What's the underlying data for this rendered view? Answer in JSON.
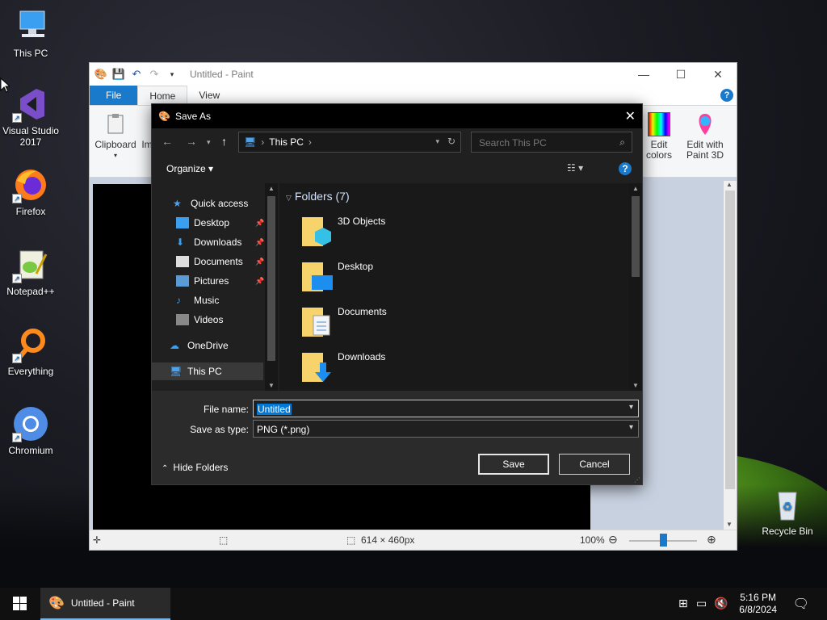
{
  "desktop": {
    "icons": [
      {
        "label": "This PC"
      },
      {
        "label": "Visual Studio\n2017"
      },
      {
        "label": "Firefox"
      },
      {
        "label": "Notepad++"
      },
      {
        "label": "Everything"
      },
      {
        "label": "Chromium"
      },
      {
        "label": "Recycle Bin"
      }
    ]
  },
  "paint": {
    "title": "Untitled - Paint",
    "tabs": {
      "file": "File",
      "home": "Home",
      "view": "View"
    },
    "ribbon": {
      "clipboard": "Clipboard",
      "edit_colors": "Edit\ncolors",
      "edit_paint3d": "Edit with\nPaint 3D",
      "images_partial": "Im"
    },
    "status": {
      "dimensions": "614 × 460px",
      "zoom": "100%",
      "zoom_fraction": 0.55
    }
  },
  "dialog": {
    "title": "Save As",
    "address": "This PC",
    "search_placeholder": "Search This PC",
    "organize": "Organize",
    "nav": [
      {
        "label": "Quick access",
        "pinned": false
      },
      {
        "label": "Desktop",
        "pinned": true
      },
      {
        "label": "Downloads",
        "pinned": true
      },
      {
        "label": "Documents",
        "pinned": true
      },
      {
        "label": "Pictures",
        "pinned": true
      },
      {
        "label": "Music",
        "pinned": false
      },
      {
        "label": "Videos",
        "pinned": false
      },
      {
        "label": "OneDrive",
        "pinned": false
      },
      {
        "label": "This PC",
        "pinned": false
      }
    ],
    "group_header": "Folders (7)",
    "folders": [
      {
        "name": "3D Objects"
      },
      {
        "name": "Desktop"
      },
      {
        "name": "Documents"
      },
      {
        "name": "Downloads"
      }
    ],
    "file_name_label": "File name:",
    "file_name_value": "Untitled",
    "save_type_label": "Save as type:",
    "save_type_value": "PNG (*.png)",
    "hide_folders": "Hide Folders",
    "save_btn": "Save",
    "cancel_btn": "Cancel"
  },
  "taskbar": {
    "task_label": "Untitled - Paint",
    "time": "5:16 PM",
    "date": "6/8/2024"
  },
  "colors": {
    "accent": "#1979ca",
    "selection": "#0078d7",
    "dialog_bg": "#202020"
  }
}
